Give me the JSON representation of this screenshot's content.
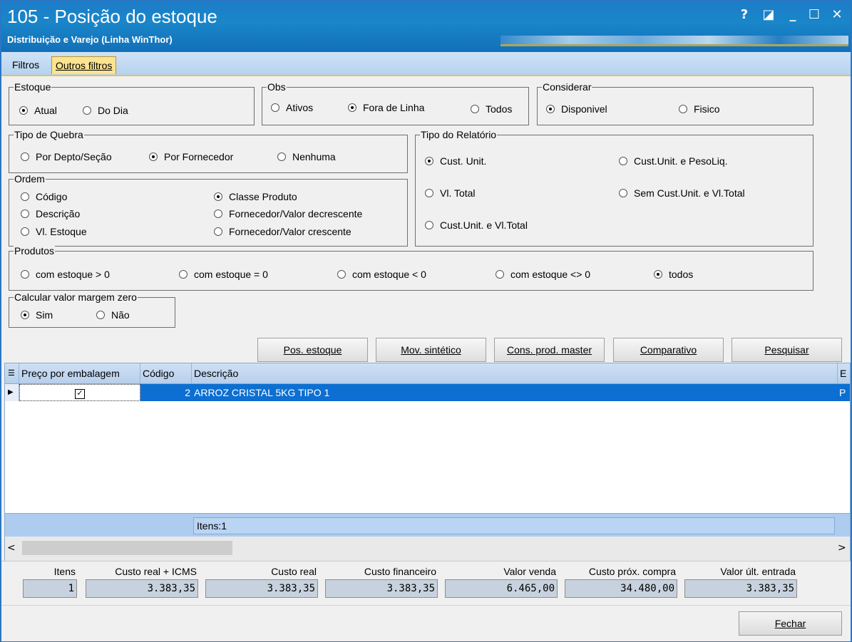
{
  "window": {
    "title": "105 - Posição do estoque",
    "subtitle": "Distribuição e Varejo (Linha WinThor)",
    "help": "?",
    "restore": "◪",
    "minimize": "_",
    "maximize": "☐",
    "close": "✕"
  },
  "tabs": [
    "Filtros",
    "Outros filtros"
  ],
  "estoque": {
    "label": "Estoque",
    "options": [
      "Atual",
      "Do Dia"
    ]
  },
  "obs": {
    "label": "Obs",
    "options": [
      "Ativos",
      "Fora de Linha",
      "Todos"
    ]
  },
  "considerar": {
    "label": "Considerar",
    "options": [
      "Disponivel",
      "Fisico"
    ]
  },
  "tipo_quebra": {
    "label": "Tipo de Quebra",
    "options": [
      "Por Depto/Seção",
      "Por Fornecedor",
      "Nenhuma"
    ]
  },
  "tipo_relatorio": {
    "label": "Tipo do Relatório",
    "options": [
      "Cust. Unit.",
      "Cust.Unit. e PesoLiq.",
      "Vl. Total",
      "Sem Cust.Unit. e Vl.Total",
      "Cust.Unit. e Vl.Total"
    ]
  },
  "ordem": {
    "label": "Ordem",
    "options": [
      "Código",
      "Descrição",
      "Vl. Estoque",
      "Classe Produto",
      "Fornecedor/Valor decrescente",
      "Fornecedor/Valor crescente"
    ]
  },
  "produtos": {
    "label": "Produtos",
    "options": [
      "com estoque > 0",
      "com estoque = 0",
      "com estoque < 0",
      "com estoque <> 0",
      "todos"
    ]
  },
  "margem": {
    "label": "Calcular valor margem zero",
    "options": [
      "Sim",
      "Não"
    ]
  },
  "buttons": [
    "Pos. estoque",
    "Mov. sintético",
    "Cons. prod. master",
    "Comparativo",
    "Pesquisar"
  ],
  "grid": {
    "columns": [
      "Preço por embalagem",
      "Código",
      "Descrição",
      "E"
    ],
    "rows": [
      {
        "codigo": "2",
        "descricao": "ARROZ CRISTAL 5KG TIPO 1",
        "extra": "P"
      }
    ],
    "footer": "Itens:1"
  },
  "totals": {
    "labels": [
      "Itens",
      "Custo real + ICMS",
      "Custo real",
      "Custo financeiro",
      "Valor venda",
      "Custo próx. compra",
      "Valor últ. entrada"
    ],
    "values": [
      "1",
      "3.383,35",
      "3.383,35",
      "3.383,35",
      "6.465,00",
      "34.480,00",
      "3.383,35"
    ]
  },
  "fechar": "Fechar"
}
